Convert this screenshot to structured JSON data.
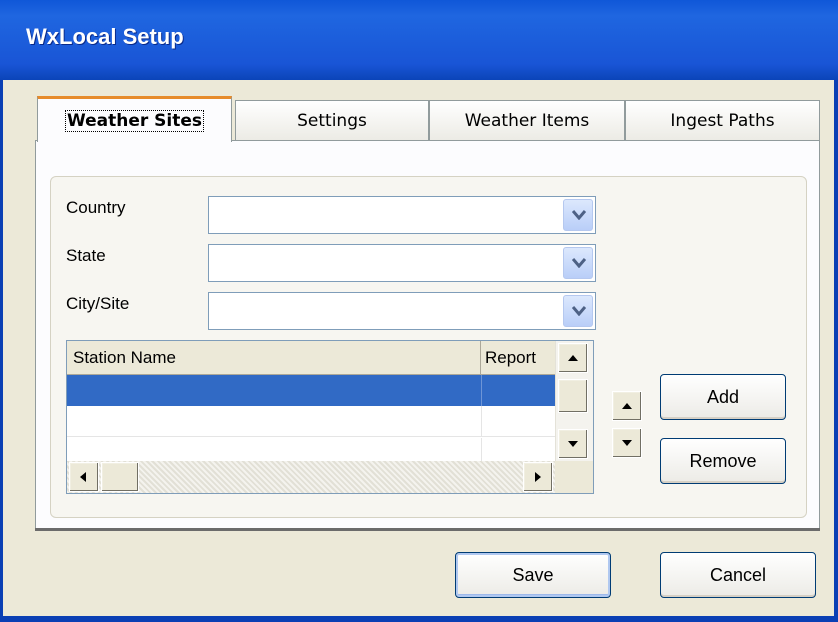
{
  "window": {
    "title": "WxLocal Setup"
  },
  "tabs": [
    {
      "label": "Weather Sites",
      "active": true
    },
    {
      "label": "Settings",
      "active": false
    },
    {
      "label": "Weather Items",
      "active": false
    },
    {
      "label": "Ingest Paths",
      "active": false
    }
  ],
  "fields": {
    "country": {
      "label": "Country",
      "value": ""
    },
    "state": {
      "label": "State",
      "value": ""
    },
    "city": {
      "label": "City/Site",
      "value": ""
    }
  },
  "stations": {
    "columns": [
      "Station  Name",
      "Report"
    ],
    "rows": [
      {
        "name": "",
        "report": "",
        "selected": true
      },
      {
        "name": "",
        "report": "",
        "selected": false
      },
      {
        "name": "",
        "report": "",
        "selected": false
      }
    ]
  },
  "buttons": {
    "add": "Add",
    "remove": "Remove",
    "save": "Save",
    "cancel": "Cancel"
  },
  "icons": {
    "dropdown": "chevron-down-icon",
    "up": "arrow-up-icon",
    "down": "arrow-down-icon",
    "left": "arrow-left-icon",
    "right": "arrow-right-icon"
  },
  "colors": {
    "title_bar": "#1f66e0",
    "selection": "#316ac5",
    "active_tab_accent": "#e68b2c"
  }
}
